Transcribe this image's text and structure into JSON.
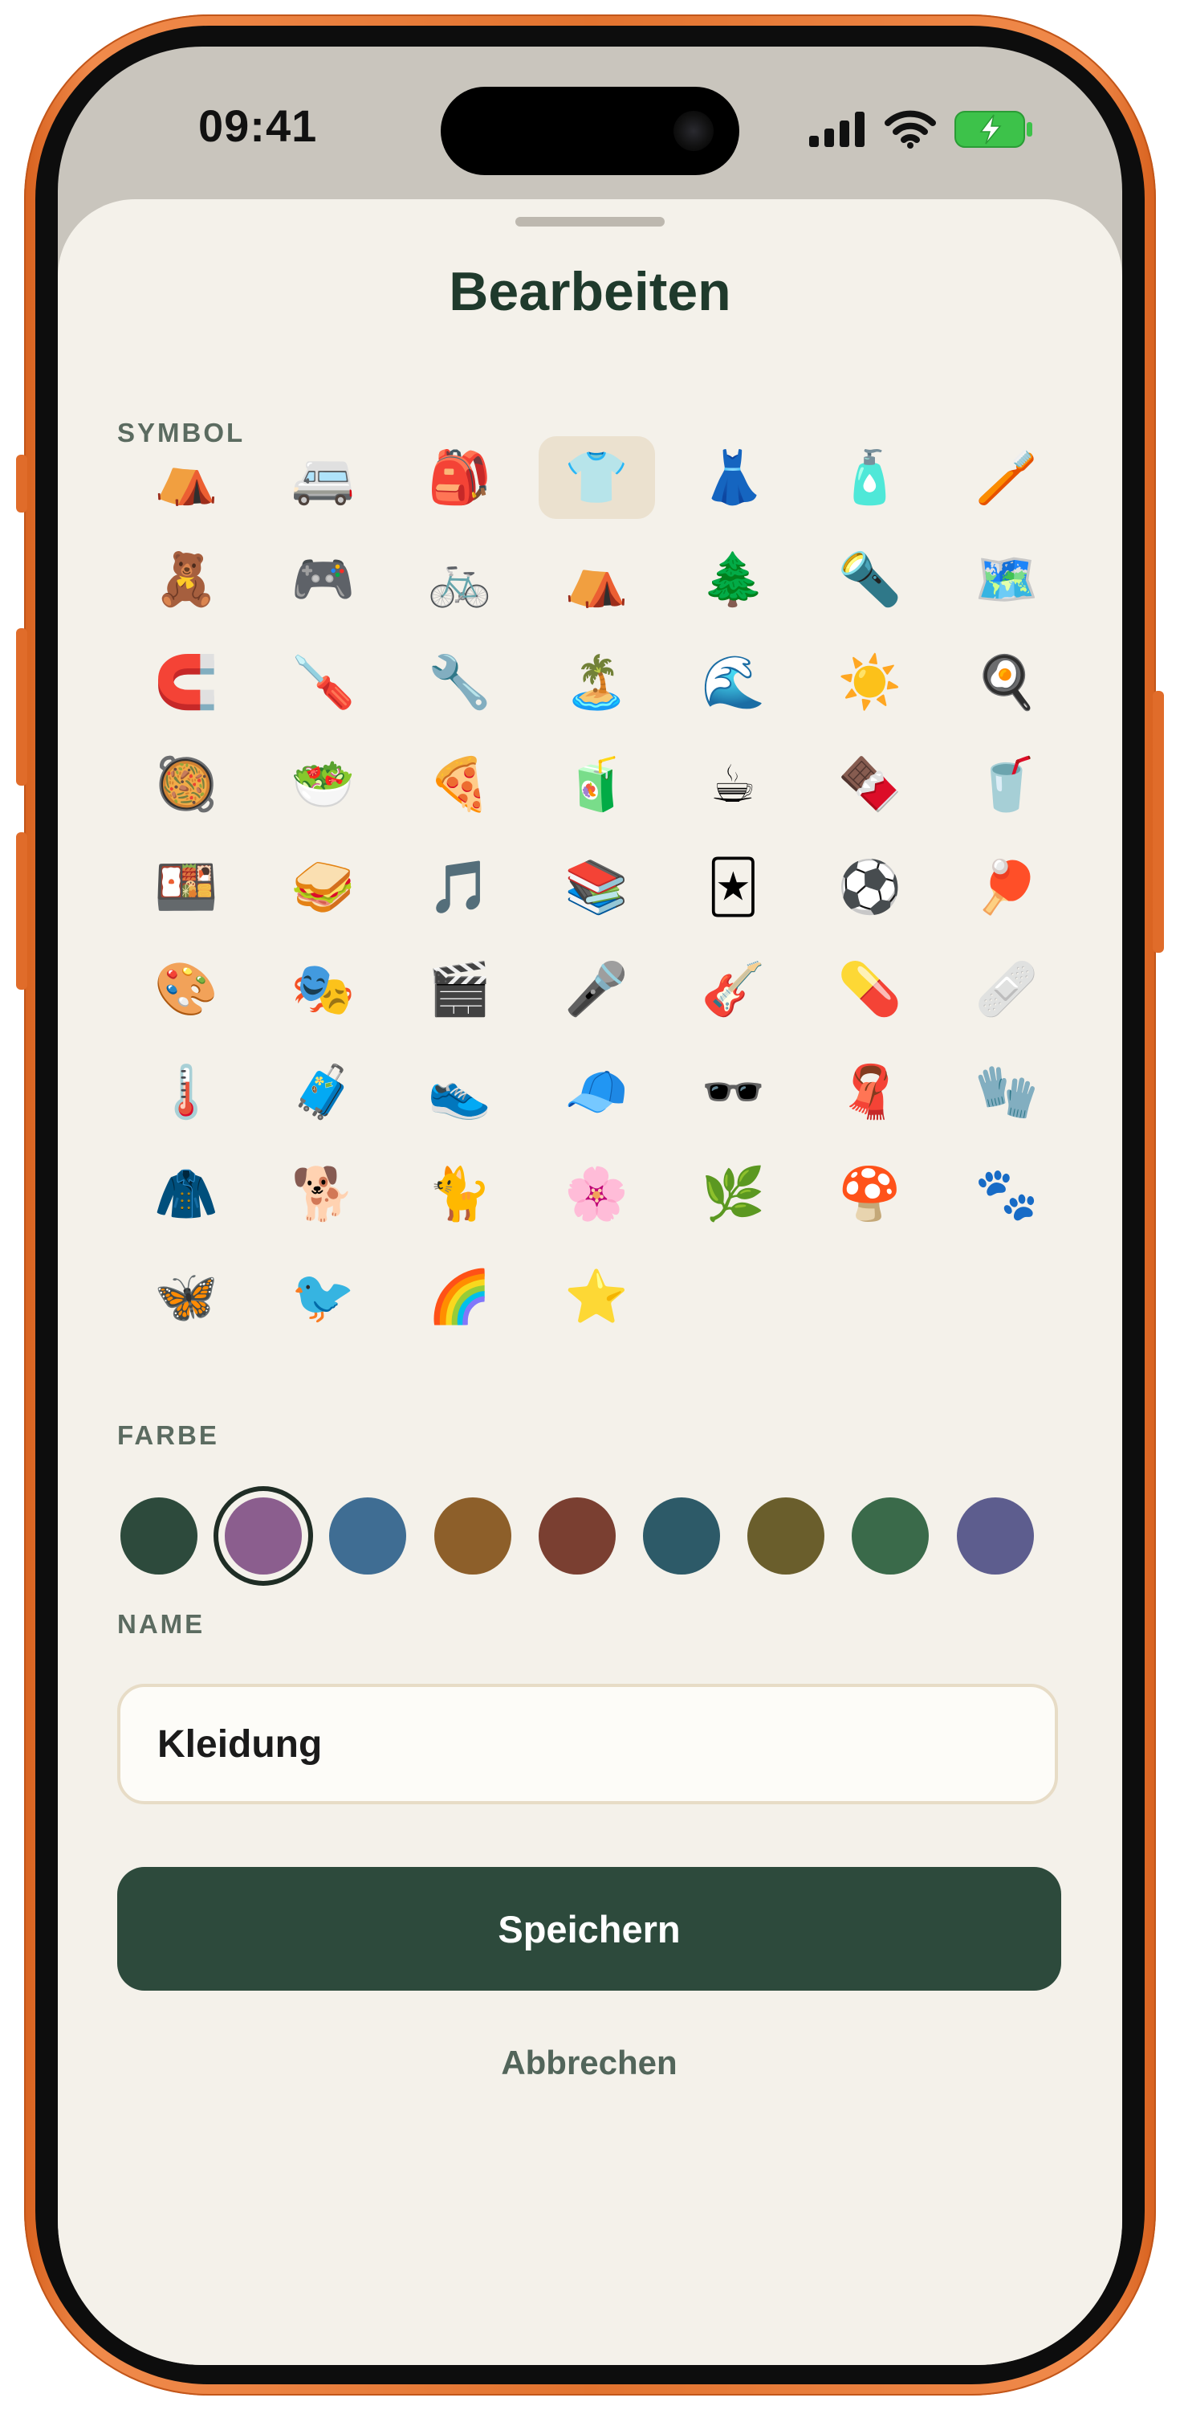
{
  "status_bar": {
    "time": "09:41"
  },
  "sheet": {
    "title": "Bearbeiten",
    "symbol_label": "SYMBOL",
    "color_label": "FARBE",
    "name_label": "NAME",
    "selected_symbol_index": 3,
    "symbols": [
      "⛺",
      "🚐",
      "🎒",
      "👕",
      "👗",
      "🧴",
      "🪥",
      "🧸",
      "🎮",
      "🚲",
      "⛺",
      "🌲",
      "🔦",
      "🗺️",
      "🧲",
      "🪛",
      "🔧",
      "🏝️",
      "🌊",
      "☀️",
      "🍳",
      "🥘",
      "🥗",
      "🍕",
      "🧃",
      "☕",
      "🍫",
      "🥤",
      "🍱",
      "🥪",
      "🎵",
      "📚",
      "🃏",
      "⚽",
      "🏓",
      "🎨",
      "🎭",
      "🎬",
      "🎤",
      "🎸",
      "💊",
      "🩹",
      "🌡️",
      "🧳",
      "👟",
      "🧢",
      "🕶️",
      "🧣",
      "🧤",
      "🧥",
      "🐕",
      "🐈",
      "🌸",
      "🌿",
      "🍄",
      "🐾",
      "🦋",
      "🐦",
      "🌈",
      "⭐"
    ],
    "selected_color_index": 1,
    "colors": [
      "#2d4a3c",
      "#8b5e8e",
      "#3f6d93",
      "#8d5f2a",
      "#7a3f31",
      "#2d5a68",
      "#6a5e2c",
      "#3a6a4a",
      "#5d5d8e"
    ],
    "name_value": "Kleidung",
    "save_label": "Speichern",
    "cancel_label": "Abbrechen"
  }
}
